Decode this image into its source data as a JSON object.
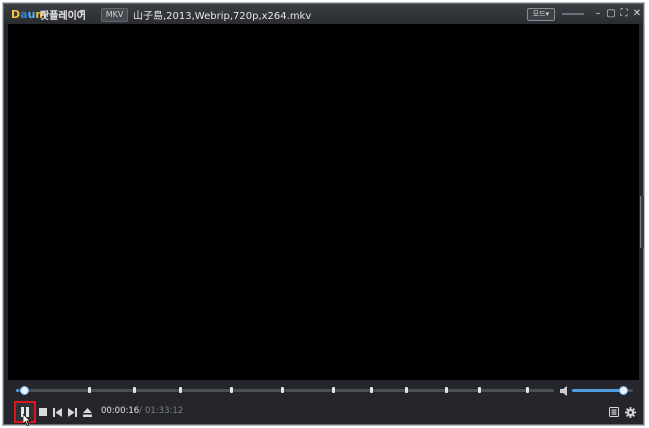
{
  "titlebar": {
    "logo": {
      "d1": "D",
      "a": "a",
      "u": "u",
      "m": "m"
    },
    "app_name": "팟플레이어",
    "app_menu_arrow": "▾",
    "format_badge": "MKV",
    "file_title": "山子島,2013,Webrip,720p,x264.mkv",
    "mode_label": "모드▾"
  },
  "window_controls": {
    "minimize": "–",
    "maximize": "▢",
    "fullscreen": "⛶",
    "close": "✕"
  },
  "playback": {
    "current_time": "00:00:16",
    "separator": "/",
    "total_time": "01:33:12",
    "progress": 0.003,
    "volume": 0.85,
    "chapter_marks": [
      0.135,
      0.22,
      0.305,
      0.4,
      0.495,
      0.59,
      0.66,
      0.725,
      0.8,
      0.86,
      0.95
    ]
  },
  "colors": {
    "accent": "#4f9ce0",
    "highlight": "#e0141b",
    "background": "#25262b",
    "video": "#000000"
  }
}
